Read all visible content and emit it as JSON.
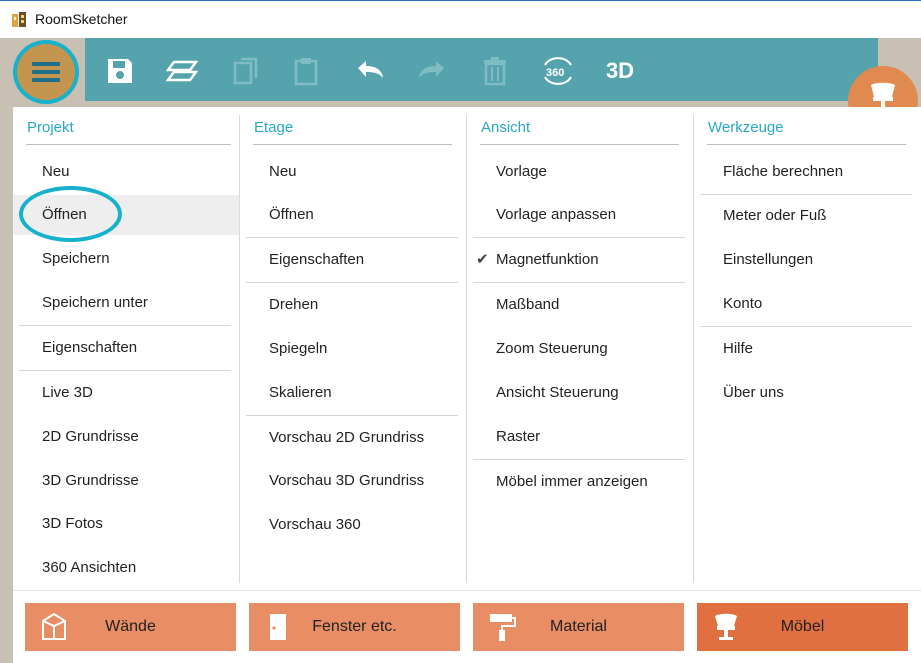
{
  "window": {
    "title": "RoomSketcher"
  },
  "toolbar": {
    "icons": [
      "menu-icon",
      "save-icon",
      "floors-icon",
      "copy-icon",
      "paste-icon",
      "undo-icon",
      "redo-icon",
      "delete-icon",
      "rotate-360-icon"
    ],
    "label_3d": "3D"
  },
  "menu": {
    "projekt": {
      "header": "Projekt",
      "items": [
        "Neu",
        "Öffnen",
        "Speichern",
        "Speichern unter",
        "Eigenschaften",
        "Live 3D",
        "2D Grundrisse",
        "3D Grundrisse",
        "3D Fotos",
        "360 Ansichten"
      ]
    },
    "etage": {
      "header": "Etage",
      "items": [
        "Neu",
        "Öffnen",
        "Eigenschaften",
        "Drehen",
        "Spiegeln",
        "Skalieren",
        "Vorschau 2D Grundriss",
        "Vorschau 3D Grundriss",
        "Vorschau 360"
      ]
    },
    "ansicht": {
      "header": "Ansicht",
      "items": [
        "Vorlage",
        "Vorlage anpassen",
        "Magnetfunktion",
        "Maßband",
        "Zoom Steuerung",
        "Ansicht Steuerung",
        "Raster",
        "Möbel immer anzeigen"
      ],
      "checked": "Magnetfunktion"
    },
    "werkzeuge": {
      "header": "Werkzeuge",
      "items": [
        "Fläche berechnen",
        "Meter oder Fuß",
        "Einstellungen",
        "Konto",
        "Hilfe",
        "Über uns"
      ]
    }
  },
  "bottom": {
    "buttons": [
      "Wände",
      "Fenster etc.",
      "Material",
      "Möbel"
    ],
    "active": "Möbel"
  },
  "colors": {
    "accent": "#27a8c4",
    "toolbar": "#55a3ad",
    "button": "#e88d64",
    "button_active": "#e0703f"
  }
}
